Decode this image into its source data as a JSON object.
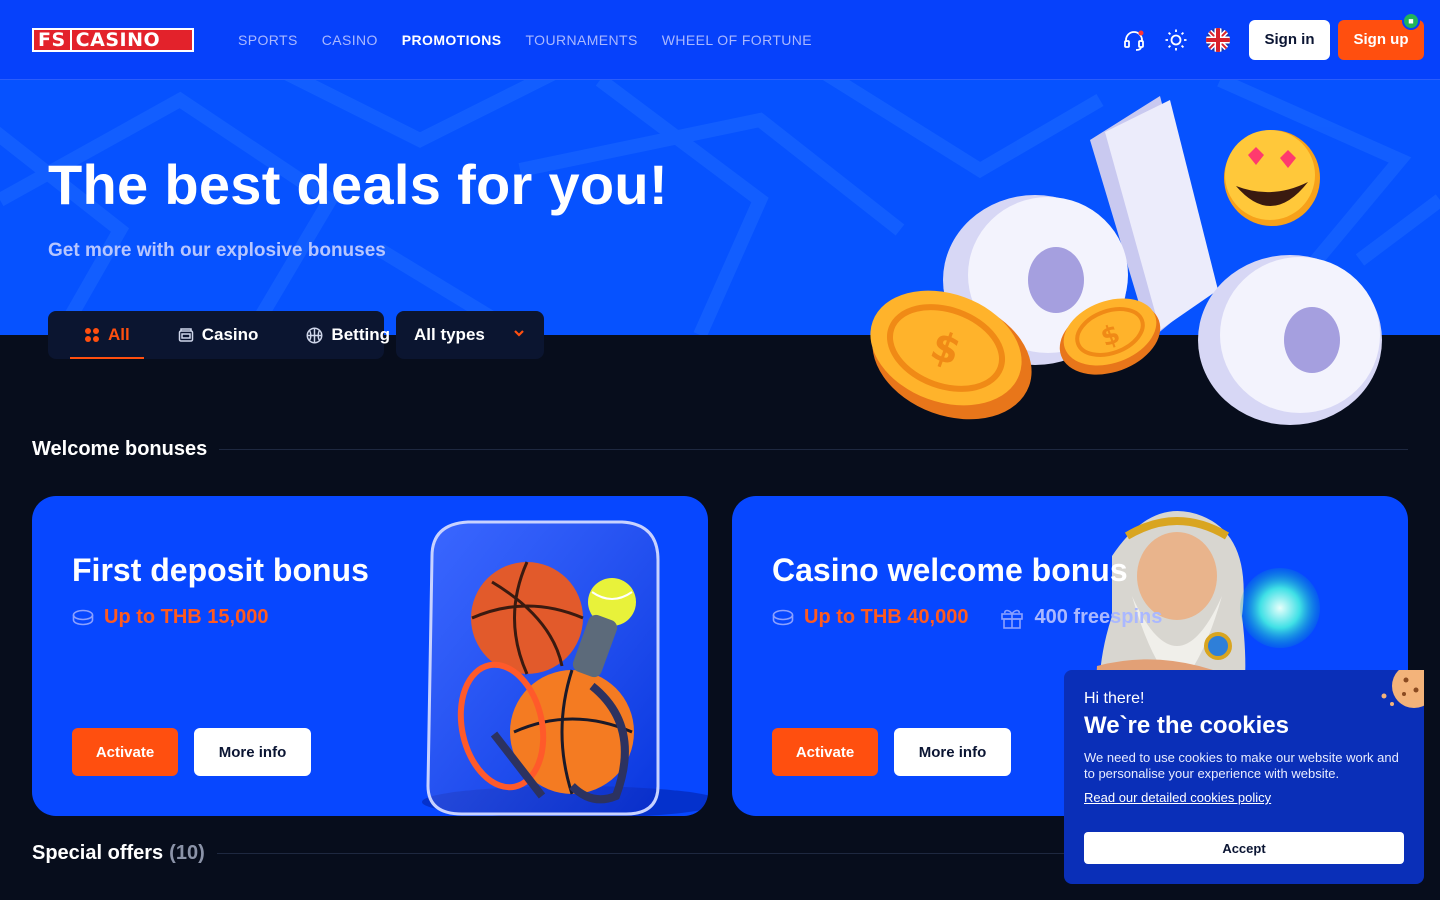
{
  "header": {
    "logo_fs": "FS",
    "logo_casino": "CASINO",
    "nav": [
      "SPORTS",
      "CASINO",
      "PROMOTIONS",
      "TOURNAMENTS",
      "WHEEL OF FORTUNE"
    ],
    "active_nav": "PROMOTIONS",
    "sign_in": "Sign in",
    "sign_up": "Sign up"
  },
  "hero": {
    "title": "The best deals for you!",
    "subtitle": "Get more with our explosive bonuses"
  },
  "filters": {
    "tabs": [
      "All",
      "Casino",
      "Betting"
    ],
    "active_tab": "All",
    "types_label": "All types"
  },
  "sections": {
    "welcome_title": "Welcome bonuses",
    "special_title": "Special offers",
    "special_count": "(10)"
  },
  "cards": [
    {
      "title": "First deposit bonus",
      "amount": "Up to THB 15,000",
      "activate": "Activate",
      "more": "More info"
    },
    {
      "title": "Casino welcome bonus",
      "amount": "Up to THB 40,000",
      "freespins": "400 freespins",
      "activate": "Activate",
      "more": "More info"
    }
  ],
  "cookies": {
    "greeting": "Hi there!",
    "title": "We`re the cookies",
    "text": "We need to use cookies to make our website work and to personalise your experience with website.",
    "link": "Read our detailed cookies policy",
    "accept": "Accept"
  },
  "colors": {
    "header_bg": "#0641fb",
    "hero_bg": "#0652ff",
    "page_bg": "#070d1c",
    "accent": "#ff4f0f",
    "card_bg": "#0747ff"
  }
}
